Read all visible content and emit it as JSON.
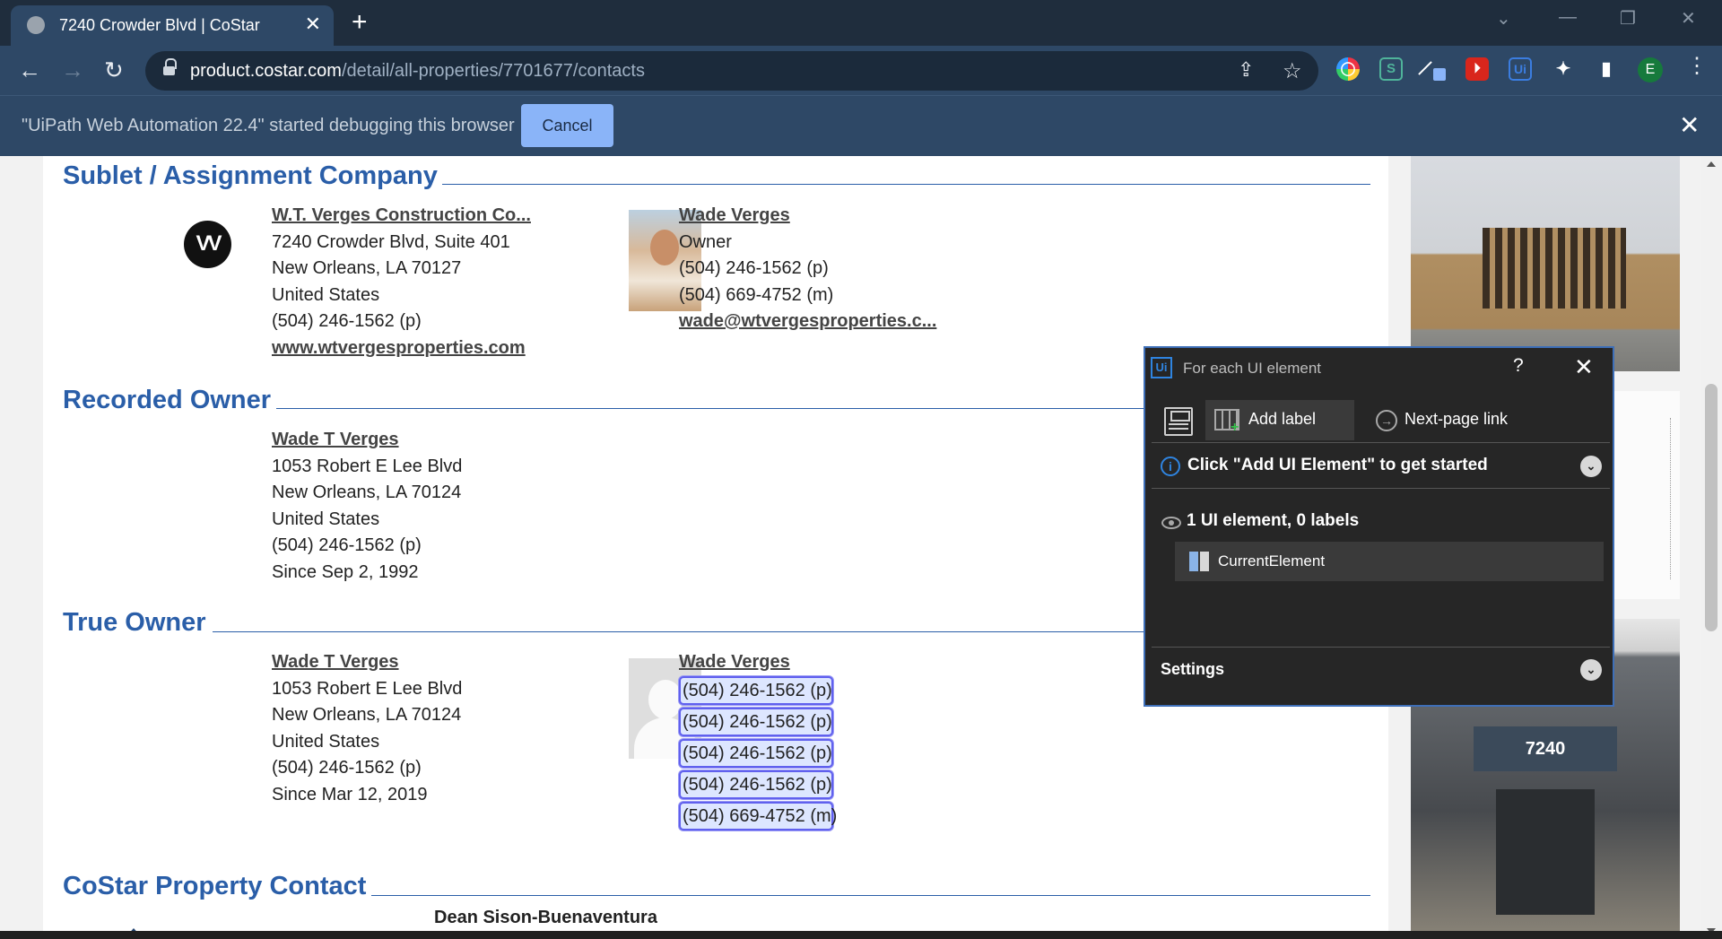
{
  "browser": {
    "tab_title": "7240 Crowder Blvd | CoStar",
    "tab_close": "✕",
    "new_tab": "+",
    "url_host": "product.costar.com",
    "url_path": "/detail/all-properties/7701677/contacts",
    "back": "←",
    "forward": "→",
    "reload": "↻",
    "window_controls": [
      "⌄",
      "—",
      "❐",
      "✕"
    ],
    "extensions": {
      "chrome_icon": "◯",
      "s_ext": "S",
      "pdf_ext": "⏵",
      "uipath_ext": "Ui",
      "puzzle": "✦",
      "sidepanel": "▮"
    },
    "profile_initial": "E",
    "menu": "⋮"
  },
  "infobar": {
    "message": "\"UiPath Web Automation 22.4\" started debugging this browser",
    "cancel_label": "Cancel",
    "close": "✕"
  },
  "sections": {
    "sublet": {
      "title": "Sublet / Assignment Company",
      "company": {
        "name": "W.T. Verges Construction Co...",
        "lines": [
          "7240 Crowder Blvd, Suite 401",
          "New Orleans, LA 70127",
          "United States",
          "(504) 246-1562 (p)"
        ],
        "website": "www.wtvergesproperties.com"
      },
      "contact": {
        "name": "Wade Verges",
        "lines": [
          "Owner",
          "(504) 246-1562 (p)",
          "(504) 669-4752 (m)"
        ],
        "email": "wade@wtvergesproperties.c..."
      }
    },
    "recorded": {
      "title": "Recorded Owner",
      "owner": {
        "name": "Wade T Verges",
        "lines": [
          "1053 Robert E Lee Blvd",
          "New Orleans, LA 70124",
          "United States",
          "(504) 246-1562 (p)",
          "Since Sep 2, 1992"
        ]
      }
    },
    "true_owner": {
      "title": "True Owner",
      "owner": {
        "name": "Wade T Verges",
        "lines": [
          "1053 Robert E Lee Blvd",
          "New Orleans, LA 70124",
          "United States",
          "(504) 246-1562 (p)",
          "Since Mar 12, 2019"
        ]
      },
      "contact": {
        "name": "Wade Verges",
        "phones": [
          "(504) 246-1562 (p)",
          "(504) 246-1562 (p)",
          "(504) 246-1562 (p)",
          "(504) 246-1562 (p)",
          "(504) 669-4752 (m)"
        ]
      }
    },
    "costar_contact": {
      "title": "CoStar Property Contact",
      "next_name": "Dean Sison-Buenaventura"
    }
  },
  "photos": {
    "building_sign": "7240"
  },
  "uipath_popup": {
    "title": "For each UI element",
    "help": "?",
    "close": "✕",
    "add_label": "Add label",
    "next_page": "Next-page link",
    "hint": "Click \"Add UI Element\" to get started",
    "count": "1 UI element, 0 labels",
    "current_element": "CurrentElement",
    "settings": "Settings",
    "chevron": "⌄",
    "info": "i",
    "plus": "+"
  },
  "colors": {
    "section_blue": "#2a5ea8",
    "chrome_bg": "#2e4866",
    "highlight_border": "#6060ee",
    "popup_bg": "#262626"
  }
}
